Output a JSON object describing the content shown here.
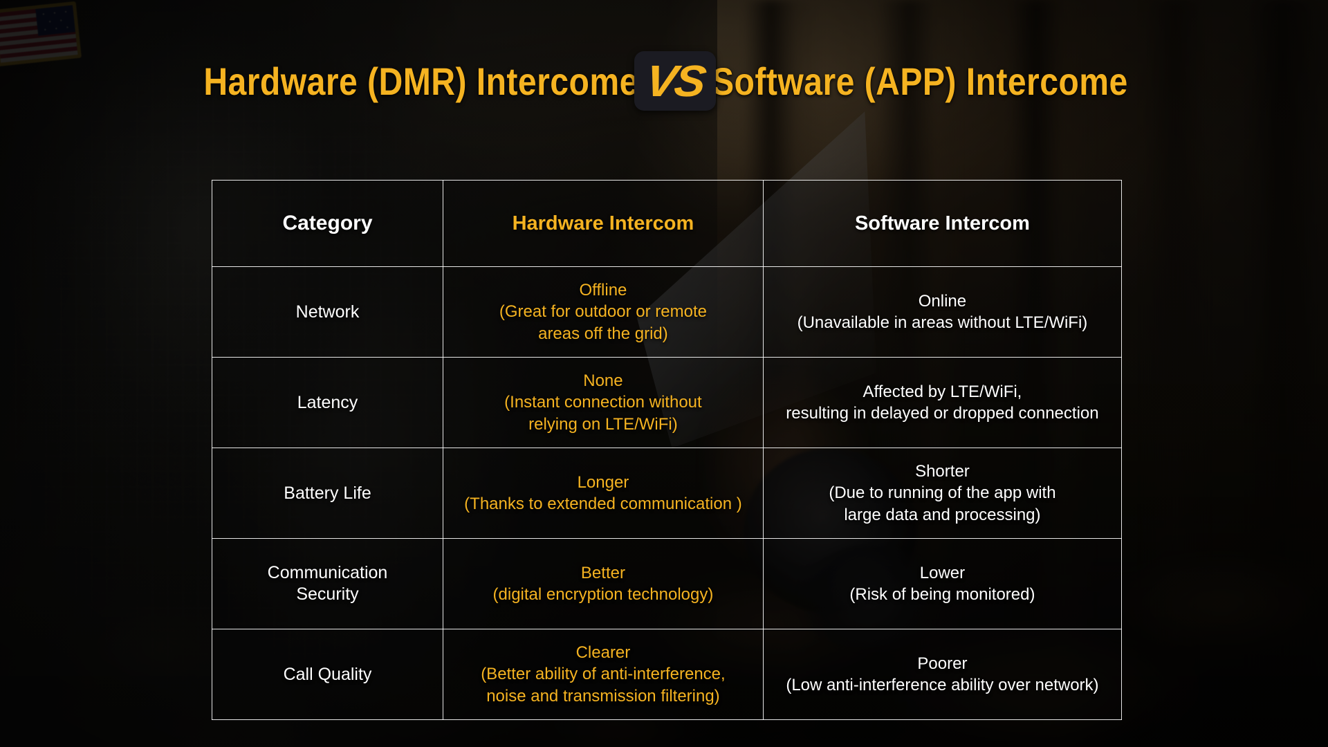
{
  "title": {
    "left": "Hardware (DMR)  Intercome",
    "badge": "VS",
    "right": "Software (APP)  Intercome",
    "accent_color": "#F5B321",
    "badge_bg_color": "#1B1B22"
  },
  "table": {
    "headers": {
      "category": "Category",
      "hardware": "Hardware Intercom",
      "software": "Software Intercom"
    },
    "rows": [
      {
        "category": "Network",
        "hardware_title": "Offline",
        "hardware_detail": "(Great for outdoor or remote\nareas off the grid)",
        "software_title": "Online",
        "software_detail": "(Unavailable in areas without LTE/WiFi)"
      },
      {
        "category": "Latency",
        "hardware_title": "None",
        "hardware_detail": "(Instant connection without\nrelying on LTE/WiFi)",
        "software_title": "Affected by LTE/WiFi,",
        "software_detail": "resulting in delayed or dropped connection"
      },
      {
        "category": "Battery Life",
        "hardware_title": "Longer",
        "hardware_detail": "(Thanks to extended communication )",
        "software_title": "Shorter",
        "software_detail": "(Due to running of the app with\nlarge data and processing)"
      },
      {
        "category": "Communication\nSecurity",
        "hardware_title": "Better",
        "hardware_detail": "(digital encryption technology)",
        "software_title": "Lower",
        "software_detail": "(Risk of being monitored)"
      },
      {
        "category": "Call Quality",
        "hardware_title": "Clearer",
        "hardware_detail": "(Better ability of anti-interference,\nnoise and transmission filtering)",
        "software_title": "Poorer",
        "software_detail": "(Low anti-interference ability over network)"
      }
    ]
  },
  "background": {
    "scene_description": "blurred dusk forest with soldier in digital camouflage holding a map and compass",
    "flag_patch": "us-flag-shoulder-patch"
  }
}
